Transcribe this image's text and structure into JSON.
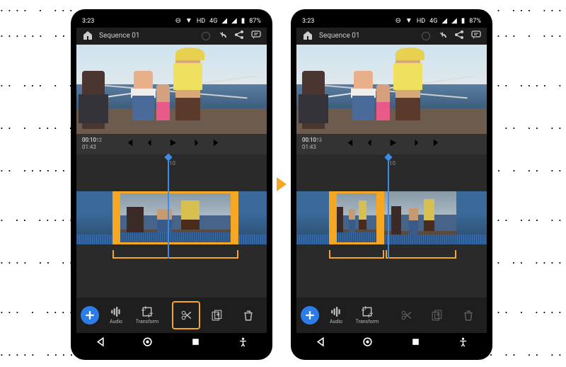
{
  "status": {
    "time": "3:23",
    "hd": "HD",
    "net": "4G",
    "battery": "87%"
  },
  "header": {
    "title": "Sequence 01"
  },
  "timecode": {
    "current": "00:10",
    "total": "01:43",
    "frame_left": "12",
    "frame_right": "13"
  },
  "ruler": {
    "mark": ":10"
  },
  "tools": {
    "audio": "Audio",
    "transform": "Transform"
  },
  "left_phone": {
    "playhead_pct": 48,
    "clips": [
      {
        "width_pct": 19,
        "selected": false,
        "bg": "water"
      },
      {
        "width_pct": 66,
        "selected": true,
        "bg": "people"
      },
      {
        "width_pct": 15,
        "selected": false,
        "bg": "water2"
      }
    ],
    "brackets": [
      {
        "left_pct": 19,
        "width_pct": 66
      }
    ],
    "split_highlighted": true
  },
  "right_phone": {
    "playhead_pct": 48,
    "clips": [
      {
        "width_pct": 17,
        "selected": false,
        "bg": "water"
      },
      {
        "width_pct": 29,
        "selected": true,
        "bg": "people"
      },
      {
        "width_pct": 38,
        "selected": false,
        "bg": "people2"
      },
      {
        "width_pct": 16,
        "selected": false,
        "bg": "water2"
      }
    ],
    "brackets": [
      {
        "left_pct": 17,
        "width_pct": 29
      },
      {
        "left_pct": 47,
        "width_pct": 37
      }
    ],
    "split_highlighted": false
  }
}
